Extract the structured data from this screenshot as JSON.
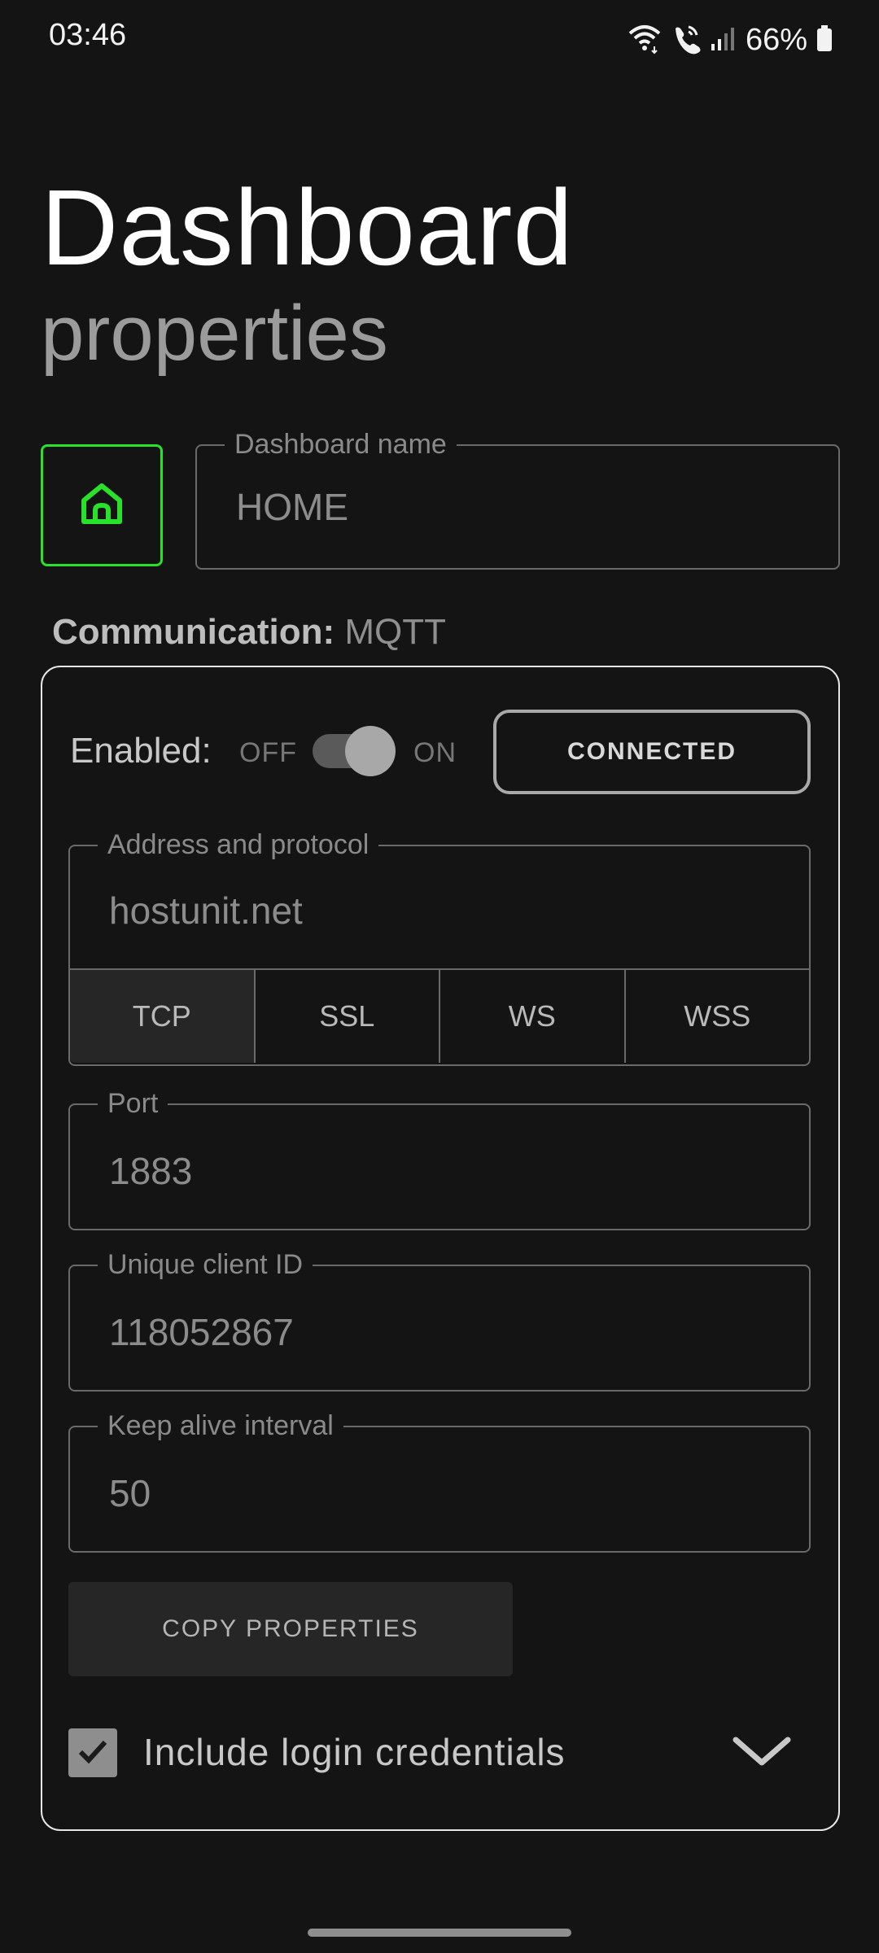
{
  "status_bar": {
    "time": "03:46",
    "battery": "66%"
  },
  "header": {
    "title": "Dashboard",
    "subtitle": "properties"
  },
  "dashboard_name": {
    "label": "Dashboard name",
    "value": "HOME"
  },
  "communication": {
    "label": "Communication:",
    "value": "MQTT"
  },
  "enabled": {
    "label": "Enabled:",
    "off": "OFF",
    "on": "ON",
    "state": "on"
  },
  "connection_button": "CONNECTED",
  "address": {
    "label": "Address and protocol",
    "value": "hostunit.net",
    "protocols": [
      "TCP",
      "SSL",
      "WS",
      "WSS"
    ],
    "selected": "TCP"
  },
  "port": {
    "label": "Port",
    "value": "1883"
  },
  "client_id": {
    "label": "Unique client ID",
    "value": "118052867"
  },
  "keep_alive": {
    "label": "Keep alive interval",
    "value": "50"
  },
  "copy_button": "COPY PROPERTIES",
  "credentials": {
    "label": "Include login credentials",
    "checked": true
  },
  "colors": {
    "accent_green": "#29e02b",
    "background": "#141414"
  }
}
